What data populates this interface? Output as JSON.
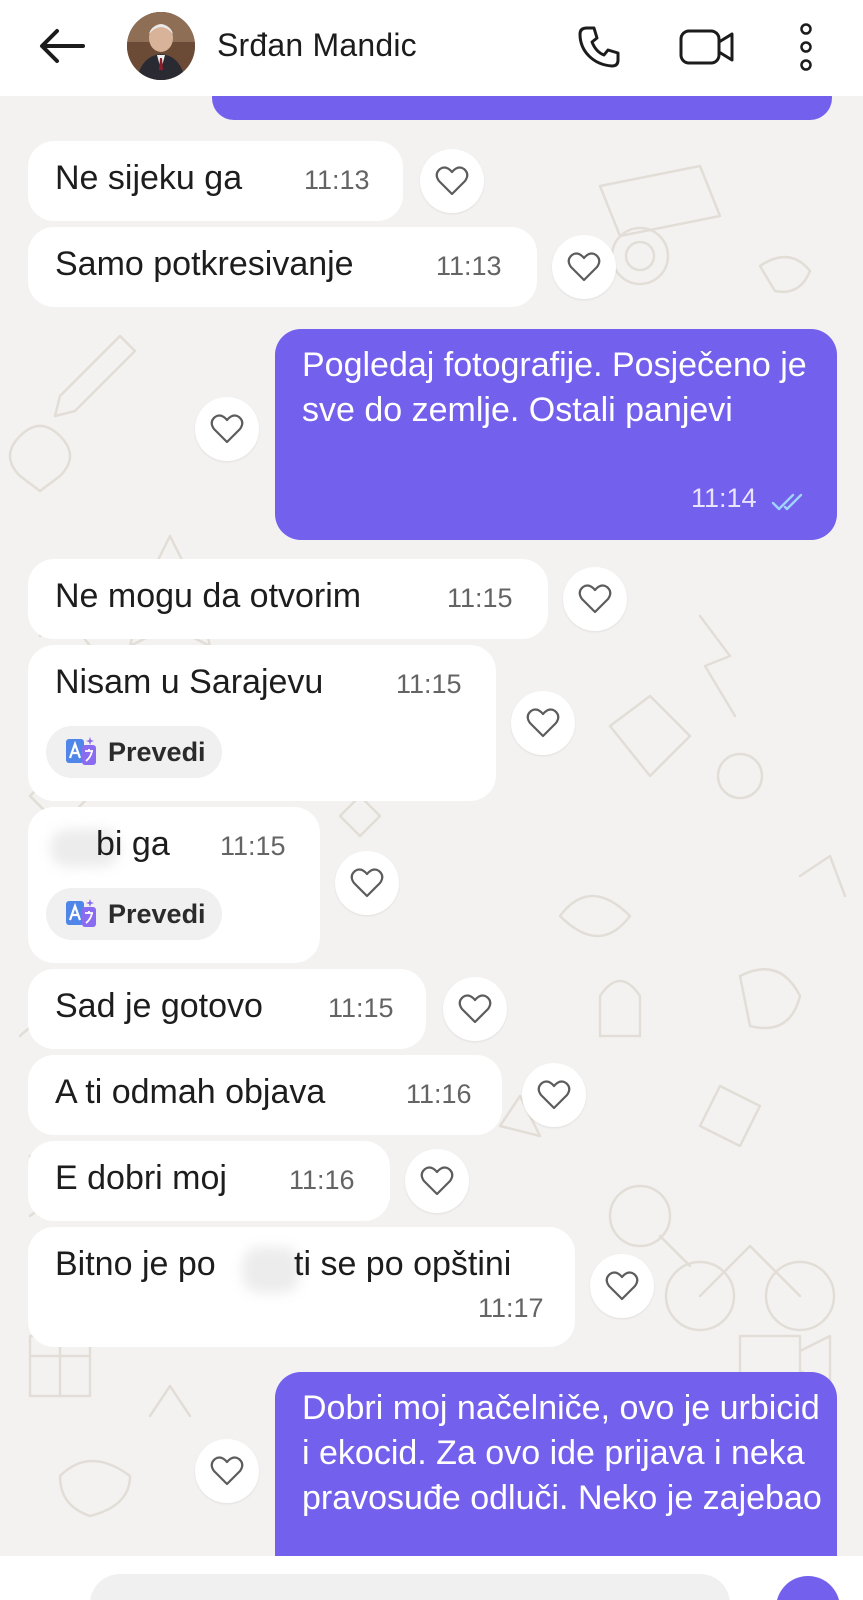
{
  "header": {
    "contact_name": "Srđan Mandic",
    "back_icon": "arrow-left-icon",
    "call_icon": "phone-icon",
    "video_icon": "video-camera-icon",
    "menu_icon": "more-vertical-icon"
  },
  "colors": {
    "outgoing_bubble": "#7360ec",
    "incoming_bubble": "#ffffff",
    "chat_background": "#f4f2f1",
    "read_ticks": "#9fd4ff"
  },
  "messages": [
    {
      "direction": "incoming",
      "text": "Ne sijeku ga",
      "time": "11:13"
    },
    {
      "direction": "incoming",
      "text": "Samo potkresivanje",
      "time": "11:13"
    },
    {
      "direction": "outgoing",
      "text": "Pogledaj fotografije. Posječeno je sve do zemlje. Ostali panjevi",
      "time": "11:14",
      "status_icon": "double-check-icon"
    },
    {
      "direction": "incoming",
      "text": "Ne mogu da otvorim",
      "time": "11:15"
    },
    {
      "direction": "incoming",
      "text": "Nisam u Sarajevu",
      "time": "11:15",
      "translate_label": "Prevedi"
    },
    {
      "direction": "incoming",
      "text": "bi ga",
      "time": "11:15",
      "translate_label": "Prevedi"
    },
    {
      "direction": "incoming",
      "text": "Sad je gotovo",
      "time": "11:15"
    },
    {
      "direction": "incoming",
      "text": "A ti odmah objava",
      "time": "11:16"
    },
    {
      "direction": "incoming",
      "text": "E dobri moj",
      "time": "11:16"
    },
    {
      "direction": "incoming",
      "text_part1": "Bitno je po",
      "text_part2": "ti se po opštini",
      "time": "11:17"
    },
    {
      "direction": "outgoing",
      "text": "Dobri moj načelniče, ovo je urbicid i ekocid. Za ovo ide prijava i neka pravosuđe odluči. Neko je zajebao"
    }
  ]
}
